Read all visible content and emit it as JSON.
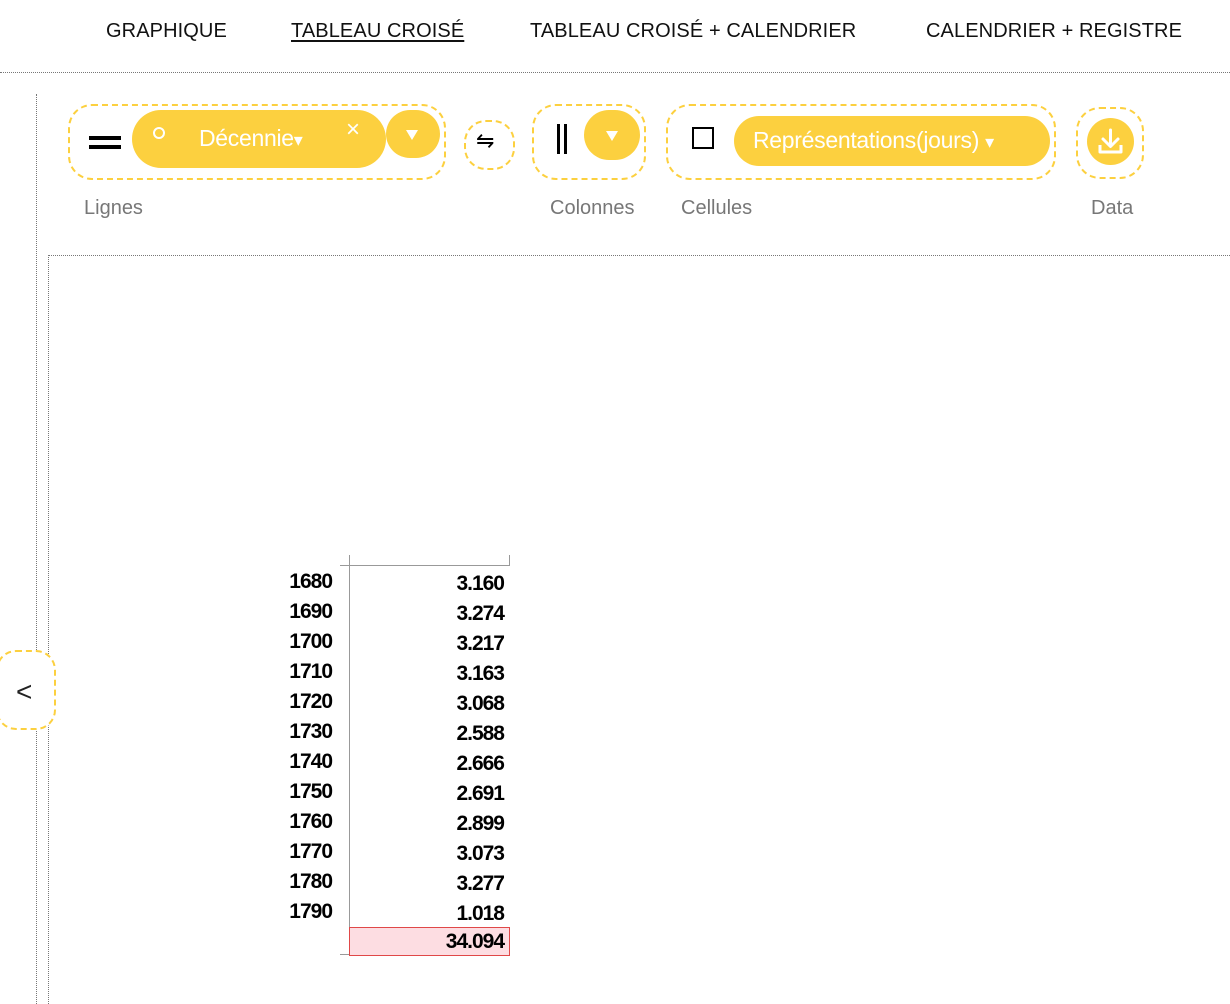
{
  "tabs": [
    {
      "label": "GRAPHIQUE",
      "active": false
    },
    {
      "label": "TABLEAU CROISÉ",
      "active": true
    },
    {
      "label": "TABLEAU CROISÉ + CALENDRIER",
      "active": false
    },
    {
      "label": "CALENDRIER + REGISTRE",
      "active": false
    }
  ],
  "controls": {
    "rows_label": "Lignes",
    "row_field": "Décennie",
    "row_field_caret": "▾",
    "row_remove": "×",
    "swap_symbol": "⇋",
    "columns_label": "Colonnes",
    "cells_label": "Cellules",
    "cell_field": "Représentations(jours)",
    "cell_field_caret": "▾",
    "data_label": "Data"
  },
  "side_toggle": "<",
  "pivot": {
    "rows": [
      {
        "key": "1680",
        "value": "3.160"
      },
      {
        "key": "1690",
        "value": "3.274"
      },
      {
        "key": "1700",
        "value": "3.217"
      },
      {
        "key": "1710",
        "value": "3.163"
      },
      {
        "key": "1720",
        "value": "3.068"
      },
      {
        "key": "1730",
        "value": "2.588"
      },
      {
        "key": "1740",
        "value": "2.666"
      },
      {
        "key": "1750",
        "value": "2.691"
      },
      {
        "key": "1760",
        "value": "2.899"
      },
      {
        "key": "1770",
        "value": "3.073"
      },
      {
        "key": "1780",
        "value": "3.277"
      },
      {
        "key": "1790",
        "value": "1.018"
      }
    ],
    "total": "34.094"
  },
  "colors": {
    "accent": "#fcd03f",
    "total_bg": "#fddde2",
    "total_border": "#e04848"
  }
}
